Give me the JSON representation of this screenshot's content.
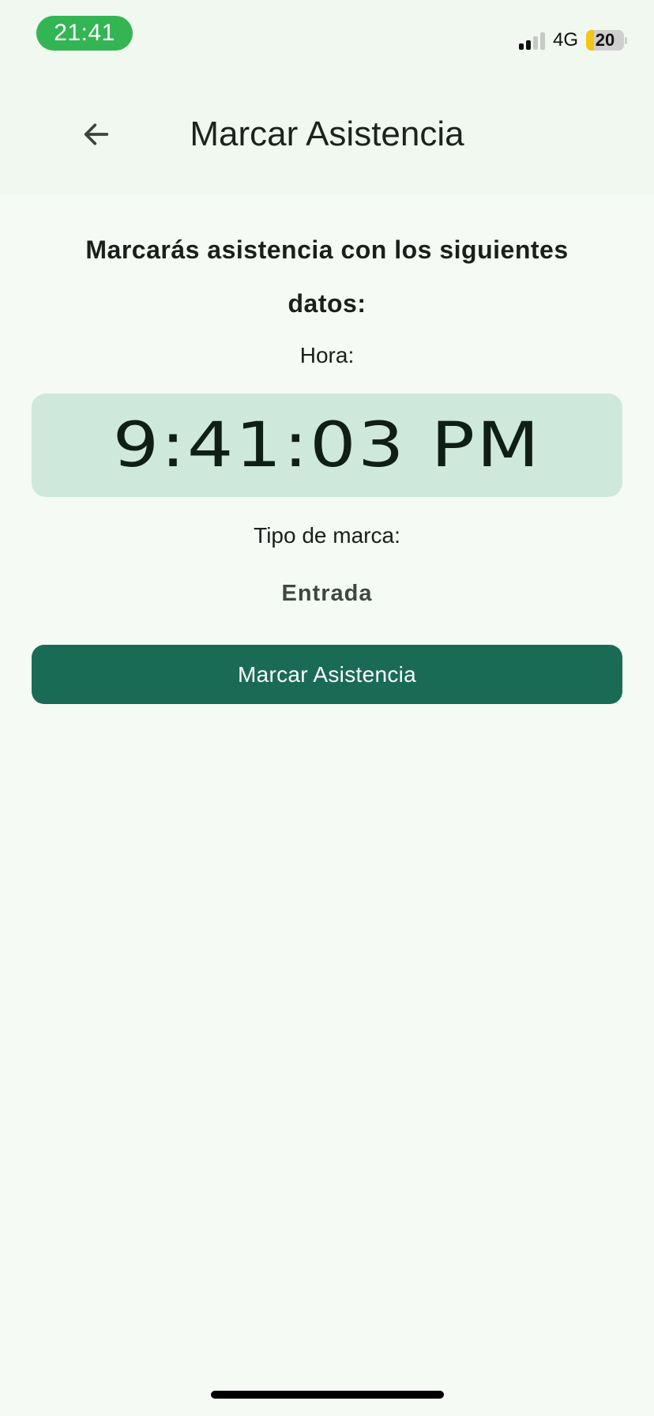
{
  "status_bar": {
    "time": "21:41",
    "network": "4G",
    "battery_level": "20",
    "battery_fraction": 0.2,
    "signal_bars_active": 2,
    "signal_bars_total": 4,
    "colors": {
      "time_pill": "#34b554",
      "battery_fill": "#f5c518"
    }
  },
  "header": {
    "back_icon": "arrow-left-icon",
    "title": "Marcar Asistencia"
  },
  "content": {
    "intro_text": "Marcarás asistencia con los siguientes datos:",
    "hora_label": "Hora:",
    "time_value": "9:41:03 PM",
    "tipo_label": "Tipo de marca:",
    "tipo_value": "Entrada"
  },
  "actions": {
    "submit_label": "Marcar Asistencia"
  },
  "colors": {
    "primary": "#1a6b55",
    "time_card_bg": "#cfe8dc",
    "background": "#f5faf5"
  }
}
